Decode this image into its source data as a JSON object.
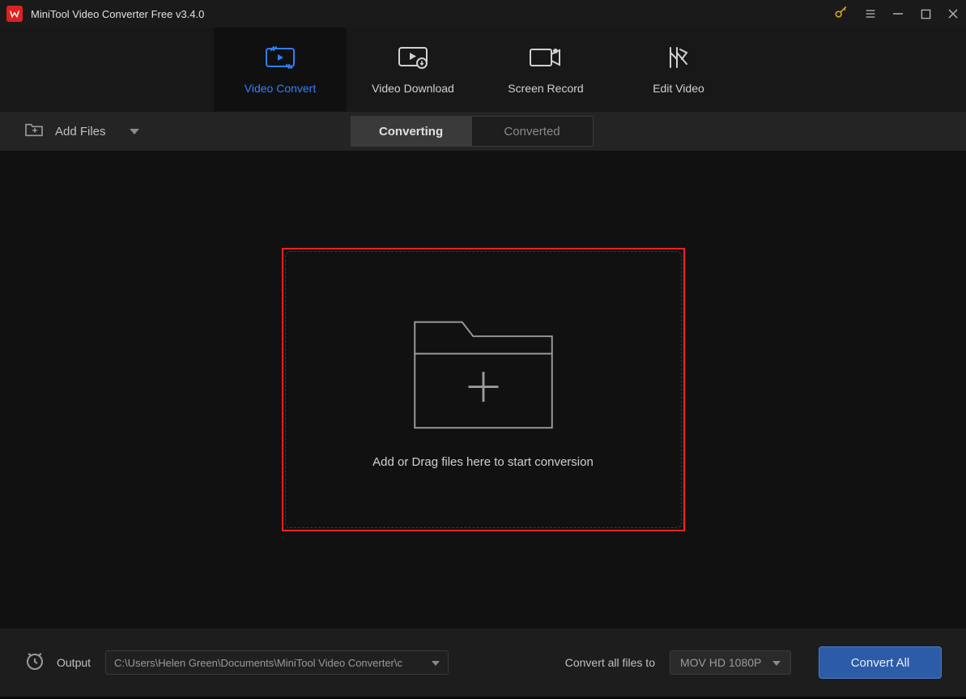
{
  "titlebar": {
    "app_title": "MiniTool Video Converter Free v3.4.0"
  },
  "tabs": {
    "items": [
      {
        "label": "Video Convert"
      },
      {
        "label": "Video Download"
      },
      {
        "label": "Screen Record"
      },
      {
        "label": "Edit Video"
      }
    ]
  },
  "toolbar": {
    "add_files_label": "Add Files",
    "sub_tabs": {
      "converting": "Converting",
      "converted": "Converted"
    }
  },
  "dropzone": {
    "text": "Add or Drag files here to start conversion"
  },
  "footer": {
    "output_label": "Output",
    "output_path": "C:\\Users\\Helen Green\\Documents\\MiniTool Video Converter\\c",
    "convert_all_label": "Convert all files to",
    "format_selected": "MOV HD 1080P",
    "convert_all_button": "Convert All"
  }
}
